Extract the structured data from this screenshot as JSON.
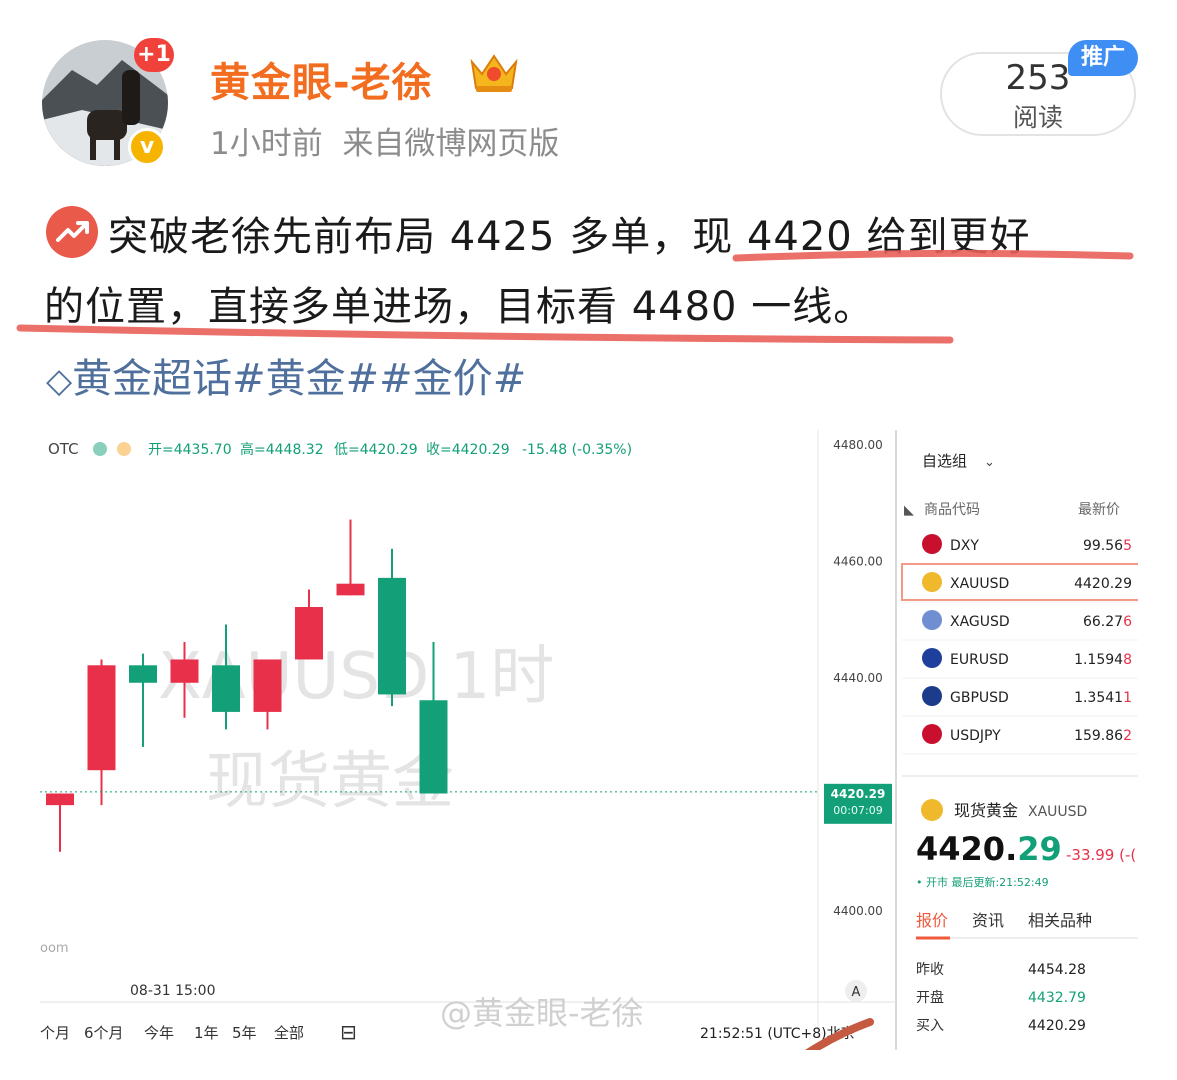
{
  "post": {
    "username": "黄金眼-老徐",
    "avatar_badge": "+1",
    "verified_mark": "v",
    "meta": "1小时前  来自微博网页版",
    "reads_count": "253",
    "reads_label": "阅读",
    "promo_label": "推广",
    "text_line1_part1": "突破老徐先前布局 4425 多单，",
    "text_line1_part2": "现 4420 给到更好",
    "text_line2_part1": "的位置，直接多单进场，",
    "text_line2_part2": "目标看 4480 一线。",
    "topics": "黄金超话#黄金##金价#",
    "watermark": "@黄金眼-老徐"
  },
  "chart_screenshot": {
    "header": {
      "source": "OTC",
      "open": "开=4435.70",
      "high": "高=4448.32",
      "low": "低=4420.29",
      "close": "收=4420.29",
      "change": "-15.48 (-0.35%)"
    },
    "watermark_line1": "XAUUSD 1时",
    "watermark_line2": "现货黄金",
    "price_label": "4420.29",
    "countdown_label": "00:07:09",
    "xaxis_label": "08-31 15:00",
    "left_fragment": "oom",
    "range_buttons": [
      "个月",
      "6个月",
      "今年",
      "1年",
      "5年",
      "全部"
    ],
    "clock": "21:52:51 (UTC+8)北京",
    "auto_label": "A",
    "colors": {
      "up": "#e8304a",
      "down": "#13a078"
    }
  },
  "chart_data": {
    "type": "candlestick",
    "title": "XAUUSD 1时",
    "y_ticks": [
      "4480.00",
      "4460.00",
      "4440.00",
      "4400.00"
    ],
    "ylim": [
      4388,
      4481
    ],
    "candles": [
      {
        "o": 4418,
        "h": 4420,
        "l": 4410,
        "c": 4420
      },
      {
        "o": 4424,
        "h": 4443,
        "l": 4418,
        "c": 4442
      },
      {
        "o": 4442,
        "h": 4444,
        "l": 4428,
        "c": 4439
      },
      {
        "o": 4439,
        "h": 4446,
        "l": 4433,
        "c": 4443
      },
      {
        "o": 4442,
        "h": 4449,
        "l": 4431,
        "c": 4434
      },
      {
        "o": 4434,
        "h": 4442,
        "l": 4431,
        "c": 4443
      },
      {
        "o": 4443,
        "h": 4455,
        "l": 4443,
        "c": 4452
      },
      {
        "o": 4454,
        "h": 4467,
        "l": 4454,
        "c": 4456
      },
      {
        "o": 4457,
        "h": 4462,
        "l": 4435,
        "c": 4437
      },
      {
        "o": 4436,
        "h": 4446,
        "l": 4420,
        "c": 4420
      }
    ],
    "current_price": 4420.29
  },
  "watchlist": {
    "group": "自选组",
    "col_symbol": "商品代码",
    "col_price": "最新价",
    "rows": [
      {
        "symbol": "DXY",
        "price": "99.56",
        "tail": "5",
        "flag": "us",
        "highlight": false
      },
      {
        "symbol": "XAUUSD",
        "price": "4420.29",
        "tail": "",
        "flag": "gold",
        "highlight": true
      },
      {
        "symbol": "XAGUSD",
        "price": "66.27",
        "tail": "6",
        "flag": "silver",
        "highlight": false
      },
      {
        "symbol": "EURUSD",
        "price": "1.1594",
        "tail": "8",
        "flag": "eu",
        "highlight": false
      },
      {
        "symbol": "GBPUSD",
        "price": "1.3541",
        "tail": "1",
        "flag": "gb",
        "highlight": false
      },
      {
        "symbol": "USDJPY",
        "price": "159.86",
        "tail": "2",
        "flag": "us",
        "highlight": false
      }
    ],
    "detail_name": "现货黄金",
    "detail_code": "XAUUSD",
    "detail_price_main": "4420.",
    "detail_price_frac": "29",
    "detail_change": "-33.99 (-(",
    "detail_status": "• 开市 最后更新:21:52:49",
    "tabs": [
      "报价",
      "资讯",
      "相关品种"
    ],
    "stats": [
      {
        "label": "昨收",
        "value": "4454.28"
      },
      {
        "label": "开盘",
        "value": "4432.79"
      },
      {
        "label": "买入",
        "value": "4420.29"
      }
    ]
  }
}
